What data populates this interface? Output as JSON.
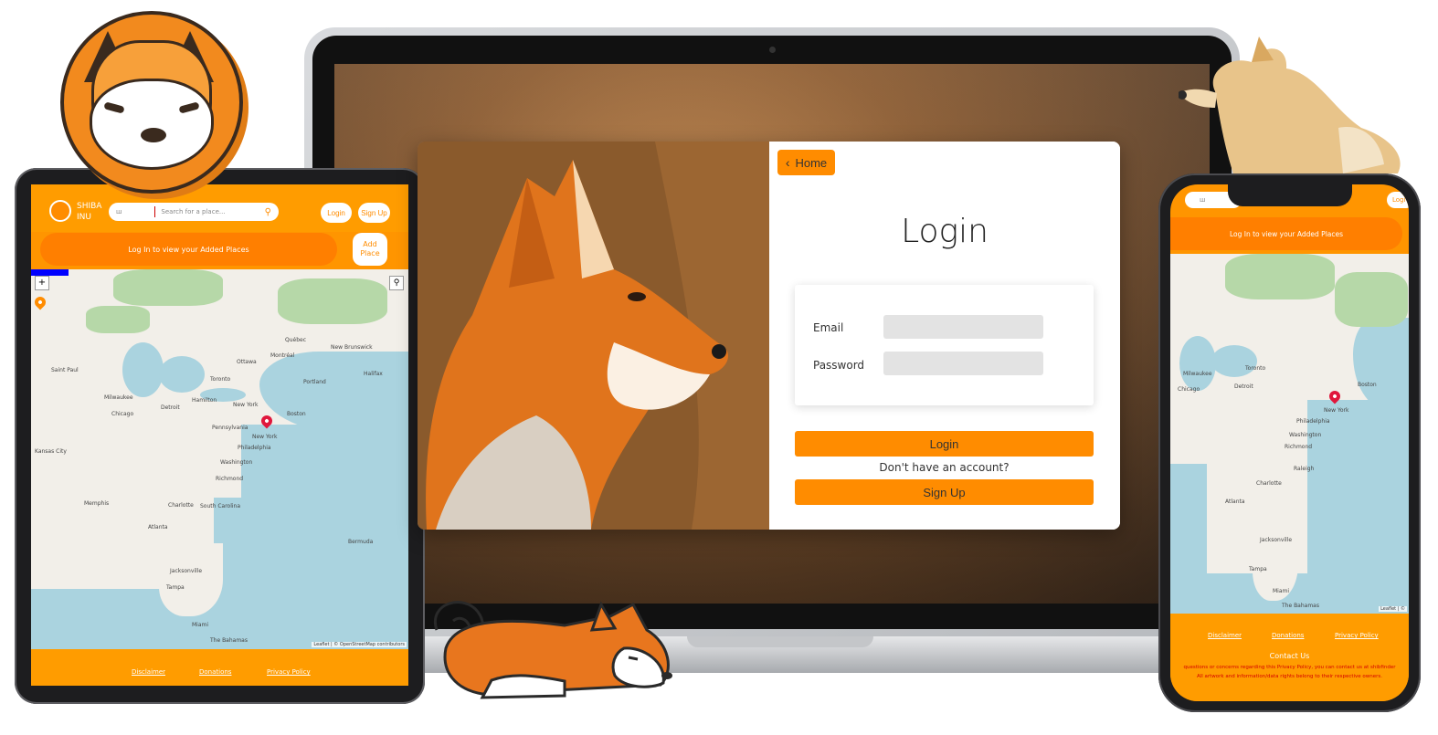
{
  "laptop": {
    "home_label": "Home",
    "login_title": "Login",
    "email_label": "Email",
    "password_label": "Password",
    "login_button": "Login",
    "no_account_text": "Don't have an account?",
    "signup_button": "Sign Up"
  },
  "tablet": {
    "brand": [
      "SHIBA",
      "INU"
    ],
    "search_placeholder": "Search for a place...",
    "search_prefix": "ш",
    "login_button": "Login",
    "signup_button": "Sign Up",
    "banner_text": "Log In to view your Added Places",
    "add_place_button": [
      "Add",
      "Place"
    ],
    "zoom_in": "+",
    "footer_links": [
      "Disclaimer",
      "Donations",
      "Privacy Policy"
    ],
    "attribution": "Leaflet | © OpenStreetMap contributors",
    "map_labels": [
      "Québec",
      "Ottawa",
      "Montréal",
      "New Brunswick",
      "Halifax",
      "Saint Paul",
      "Toronto",
      "Portland",
      "Milwaukee",
      "Hamilton",
      "Boston",
      "Detroit",
      "New York",
      "Chicago",
      "Pennsylvania",
      "New York",
      "Kansas City",
      "Philadelphia",
      "Washington",
      "Richmond",
      "Memphis",
      "Charlotte",
      "South Carolina",
      "Atlanta",
      "Bermuda",
      "Jacksonville",
      "Tampa",
      "Miami",
      "The Bahamas"
    ]
  },
  "phone": {
    "search_prefix": "ш",
    "login_button": "Logi",
    "banner_text": "Log In to view your Added Places",
    "footer_links": [
      "Disclaimer",
      "Donations",
      "Privacy Policy"
    ],
    "contact_title": "Contact Us",
    "contact_line1": "questions or concerns regarding this Privacy Policy, you can contact us at shibfinder",
    "contact_line2": "All artwork and information/data rights belong to their respective owners.",
    "attribution": "Leaflet | ©",
    "map_labels": [
      "Toronto",
      "Milwaukee",
      "Chicago",
      "Detroit",
      "New York",
      "Philadelphia",
      "Washington",
      "Richmond",
      "Raleigh",
      "Charlotte",
      "Atlanta",
      "Jacksonville",
      "Tampa",
      "Miami",
      "The Bahamas",
      "Boston"
    ]
  },
  "colors": {
    "accent": "#ff8c00",
    "header": "#ff9c00",
    "banner": "#ff7f00",
    "pin": "#e0173c",
    "water": "#aad3df",
    "land": "#f2efe9"
  }
}
